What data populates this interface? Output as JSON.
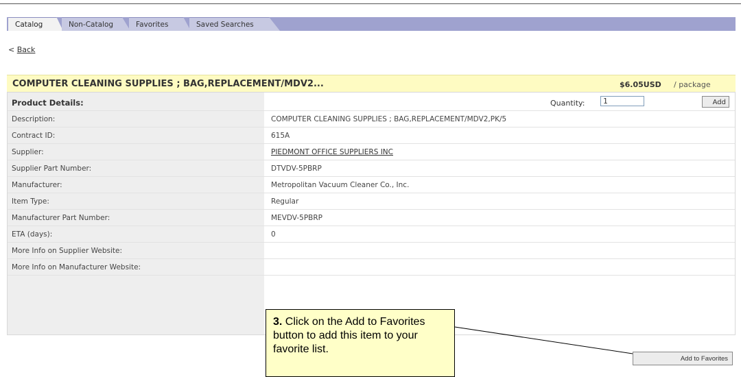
{
  "tabs": [
    {
      "label": "Catalog"
    },
    {
      "label": "Non-Catalog"
    },
    {
      "label": "Favorites"
    },
    {
      "label": "Saved Searches"
    }
  ],
  "back": {
    "prefix": "<",
    "label": "Back"
  },
  "product": {
    "title": "COMPUTER CLEANING SUPPLIES ; BAG,REPLACEMENT/MDV2...",
    "price": "$6.05USD",
    "unit": "/ package"
  },
  "details": {
    "header": "Product Details:",
    "quantity_label": "Quantity:",
    "quantity_value": "1",
    "add_label": "Add",
    "rows": [
      {
        "label": "Description:",
        "value": "COMPUTER CLEANING SUPPLIES ; BAG,REPLACEMENT/MDV2,PK/5"
      },
      {
        "label": "Contract ID:",
        "value": "615A"
      },
      {
        "label": "Supplier:",
        "value": "PIEDMONT OFFICE SUPPLIERS INC"
      },
      {
        "label": "Supplier Part Number:",
        "value": "DTVDV-5PBRP"
      },
      {
        "label": "Manufacturer:",
        "value": "Metropolitan Vacuum Cleaner Co., Inc."
      },
      {
        "label": "Item Type:",
        "value": "Regular"
      },
      {
        "label": "Manufacturer Part Number:",
        "value": "MEVDV-5PBRP"
      },
      {
        "label": "ETA (days):",
        "value": "0"
      },
      {
        "label": "More Info on Supplier Website:",
        "value": ""
      },
      {
        "label": "More Info on Manufacturer Website:",
        "value": ""
      }
    ]
  },
  "callout": {
    "step": "3.",
    "text": "Click on the Add to Favorites button to add this item to your favorite list."
  },
  "favorites_button": {
    "label": "Add to Favorites"
  }
}
